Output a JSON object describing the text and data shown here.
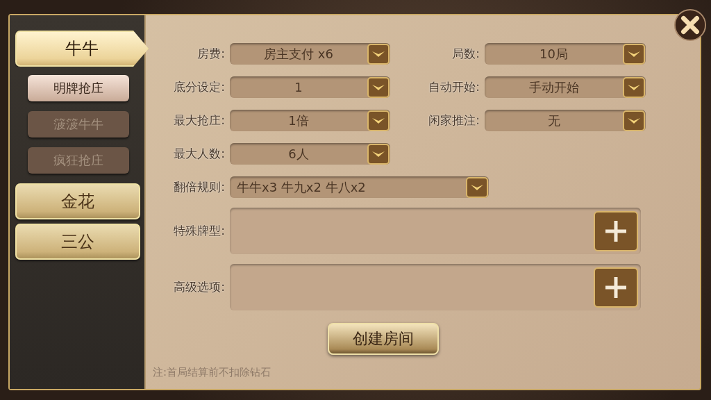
{
  "games": [
    {
      "label": "牛牛",
      "selected": true,
      "children": [
        {
          "label": "明牌抢庄",
          "selected": true
        },
        {
          "label": "箥箥牛牛",
          "selected": false
        },
        {
          "label": "疯狂抢庄",
          "selected": false
        }
      ]
    },
    {
      "label": "金花",
      "selected": false
    },
    {
      "label": "三公",
      "selected": false
    }
  ],
  "form": {
    "left": [
      {
        "label": "房费:",
        "value": "房主支付 x6"
      },
      {
        "label": "底分设定:",
        "value": "1"
      },
      {
        "label": "最大抢庄:",
        "value": "1倍"
      },
      {
        "label": "最大人数:",
        "value": "6人"
      }
    ],
    "right": [
      {
        "label": "局数:",
        "value": "10局"
      },
      {
        "label": "自动开始:",
        "value": "手动开始"
      },
      {
        "label": "闲家推注:",
        "value": "无"
      }
    ],
    "double_rule": {
      "label": "翻倍规则:",
      "value": "牛牛x3  牛九x2  牛八x2"
    },
    "extras": [
      {
        "label": "特殊牌型:"
      },
      {
        "label": "高级选项:"
      }
    ]
  },
  "create_button": "创建房间",
  "note": "注:首局结算前不扣除钻石"
}
